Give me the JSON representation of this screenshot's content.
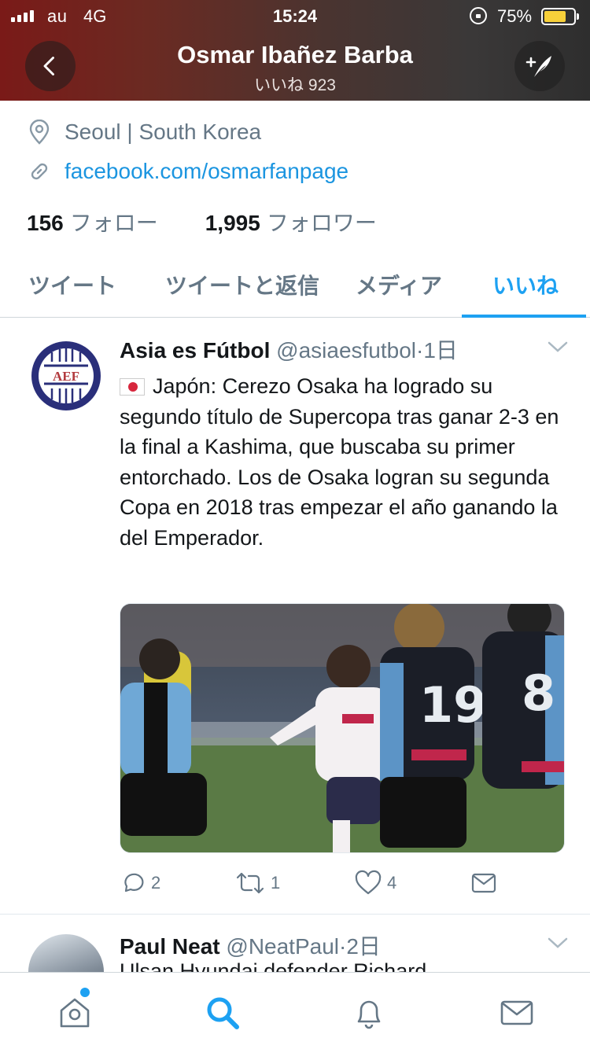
{
  "status_bar": {
    "carrier": "au",
    "network": "4G",
    "time": "15:24",
    "battery": "75%",
    "battery_level": 0.75
  },
  "header": {
    "title": "Osmar Ibañez Barba",
    "subtitle": "いいね 923",
    "back_icon": "chevron-left-icon",
    "compose_icon": "compose-tweet-icon"
  },
  "profile": {
    "location": "Seoul | South Korea",
    "website": "facebook.com/osmarfanpage",
    "following_count": "156",
    "following_label": "フォロー",
    "followers_count": "1,995",
    "followers_label": "フォロワー"
  },
  "tabs": [
    {
      "label": "ツイート",
      "active": false
    },
    {
      "label": "ツイートと返信",
      "active": false
    },
    {
      "label": "メディア",
      "active": false
    },
    {
      "label": "いいね",
      "active": true
    }
  ],
  "tweets": [
    {
      "name": "Asia es Fútbol",
      "handle": "@asiaesfutbol",
      "time": "1日",
      "avatar_text": "AEF",
      "text": "Japón: Cerezo Osaka ha logrado su segundo título de Supercopa tras ganar 2-3 en la final a Kashima, que buscaba su primer entorchado. Los de Osaka logran su segunda Copa en 2018 tras empezar el año ganando la del Emperador.",
      "replies": "2",
      "retweets": "1",
      "likes": "4"
    },
    {
      "name": "Paul Neat",
      "handle": "@NeatPaul",
      "time": "2日",
      "text": "Ulsan Hyundai defender Richard"
    }
  ],
  "tabbar": {
    "items": [
      "home-icon",
      "search-icon",
      "notifications-icon",
      "messages-icon"
    ],
    "active": "search-icon",
    "accent": "#1da1f2"
  }
}
